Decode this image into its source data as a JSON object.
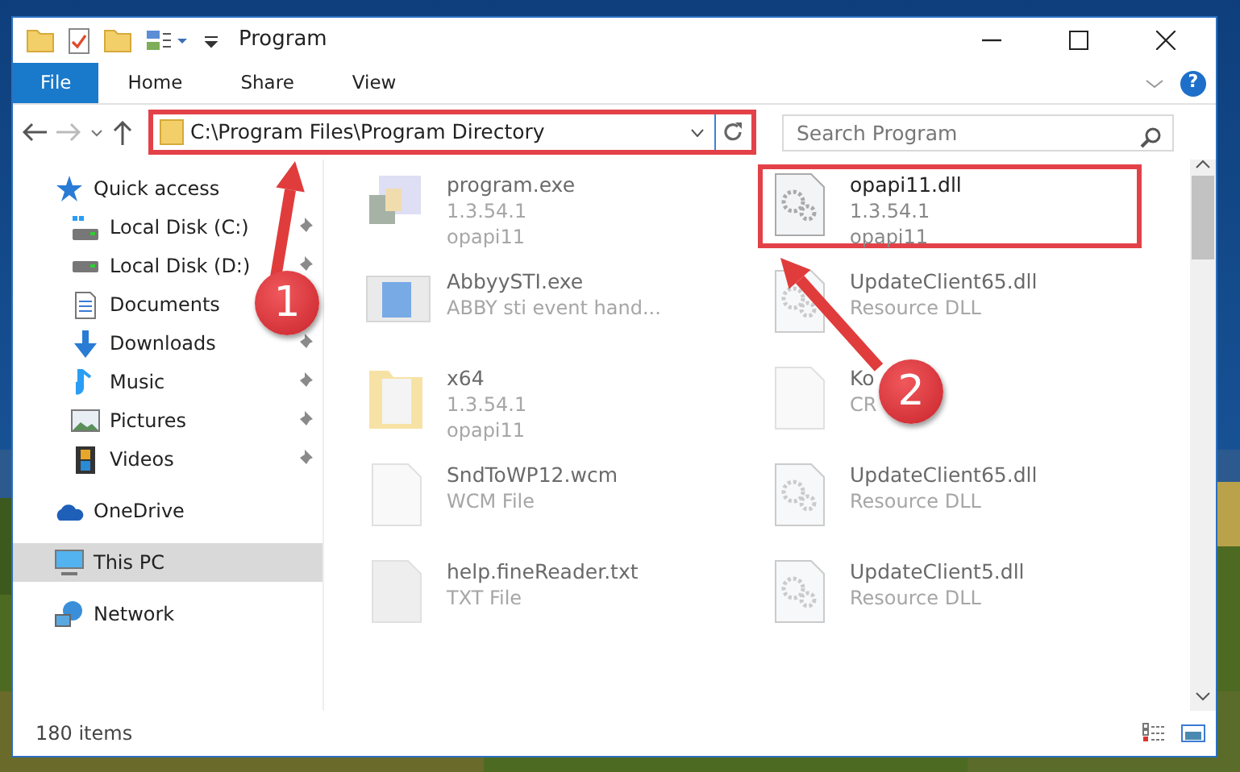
{
  "window": {
    "title": "Program"
  },
  "ribbon": {
    "tabs": [
      {
        "label": "File",
        "selected": true
      },
      {
        "label": "Home",
        "selected": false
      },
      {
        "label": "Share",
        "selected": false
      },
      {
        "label": "View",
        "selected": false
      }
    ],
    "help": "?"
  },
  "address": {
    "path": "C:\\Program Files\\Program Directory",
    "highlighted": true
  },
  "search": {
    "placeholder": "Search Program"
  },
  "sidebar": {
    "items": [
      {
        "label": "Quick access",
        "kind": "star",
        "selected": false,
        "children": [
          {
            "label": "Local Disk (C:)",
            "kind": "system-disk",
            "pinned": true,
            "selected": false
          },
          {
            "label": "Local Disk (D:)",
            "kind": "disk",
            "pinned": true,
            "selected": false
          },
          {
            "label": "Documents",
            "kind": "documents",
            "pinned": false,
            "selected": false
          },
          {
            "label": "Downloads",
            "kind": "download",
            "pinned": true,
            "selected": false
          },
          {
            "label": "Music",
            "kind": "music",
            "pinned": true,
            "selected": false
          },
          {
            "label": "Pictures",
            "kind": "pictures",
            "pinned": true,
            "selected": false
          },
          {
            "label": "Videos",
            "kind": "videos",
            "pinned": true,
            "selected": false
          }
        ]
      },
      {
        "label": "OneDrive",
        "kind": "cloud",
        "selected": false
      },
      {
        "label": "This PC",
        "kind": "pc",
        "selected": true
      },
      {
        "label": "Network",
        "kind": "network",
        "selected": false
      }
    ]
  },
  "files": [
    {
      "kind": "program",
      "name": "program.exe",
      "lines": [
        "1.3.54.1",
        "opapi11"
      ],
      "faded": true,
      "highlighted": false
    },
    {
      "kind": "dll",
      "name": "opapi11.dll",
      "lines": [
        "1.3.54.1",
        "opapi11"
      ],
      "faded": false,
      "highlighted": true
    },
    {
      "kind": "window",
      "name": "AbbyySTI.exe",
      "lines": [
        "ABBY sti event hand..."
      ],
      "faded": true,
      "highlighted": false
    },
    {
      "kind": "dll",
      "name": "UpdateClient65.dll",
      "lines": [
        "Resource DLL"
      ],
      "faded": true,
      "highlighted": false
    },
    {
      "kind": "folder",
      "name": "x64",
      "lines": [
        "1.3.54.1",
        "opapi11"
      ],
      "faded": true,
      "highlighted": false
    },
    {
      "kind": "file",
      "name": "Ko",
      "lines": [
        "CR"
      ],
      "faded": true,
      "highlighted": false
    },
    {
      "kind": "file",
      "name": "SndToWP12.wcm",
      "lines": [
        "WCM File"
      ],
      "faded": true,
      "highlighted": false
    },
    {
      "kind": "dll",
      "name": "UpdateClient65.dll",
      "lines": [
        "Resource DLL"
      ],
      "faded": true,
      "highlighted": false
    },
    {
      "kind": "text",
      "name": "help.fineReader.txt",
      "lines": [
        "TXT File"
      ],
      "faded": true,
      "highlighted": false
    },
    {
      "kind": "dll",
      "name": "UpdateClient5.dll",
      "lines": [
        "Resource DLL"
      ],
      "faded": true,
      "highlighted": false
    }
  ],
  "status_bar": {
    "count": "180 items"
  },
  "annotations": [
    {
      "number": "1"
    },
    {
      "number": "2"
    }
  ]
}
